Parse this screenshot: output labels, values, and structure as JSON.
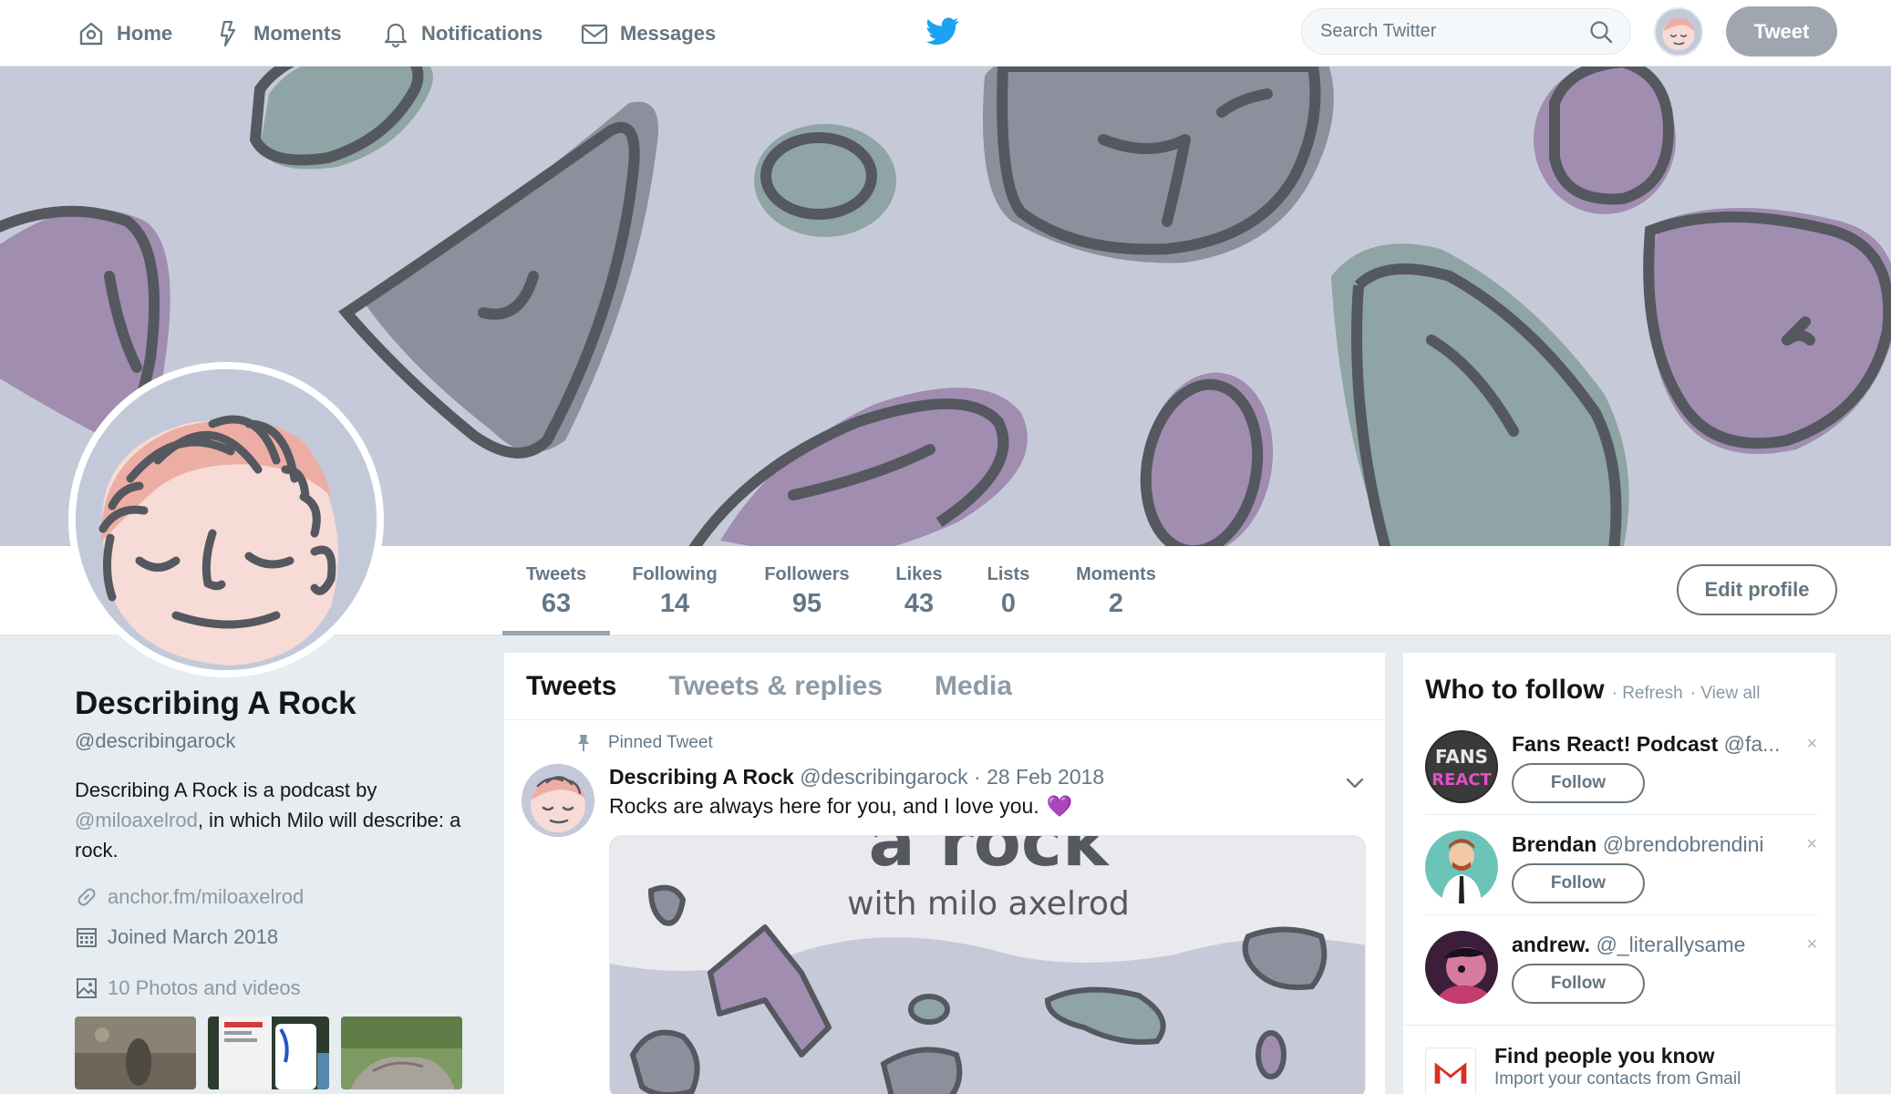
{
  "nav": {
    "home": "Home",
    "moments": "Moments",
    "notifications": "Notifications",
    "messages": "Messages",
    "search_placeholder": "Search Twitter",
    "tweet_button": "Tweet"
  },
  "profile": {
    "name": "Describing A Rock",
    "handle": "@describingarock",
    "bio_prefix": "Describing A Rock is a podcast by ",
    "bio_mention": "@miloaxelrod",
    "bio_suffix": ", in which Milo will describe: a rock.",
    "website": "anchor.fm/miloaxelrod",
    "joined": "Joined March 2018",
    "photos": "10 Photos and videos",
    "edit_button": "Edit profile"
  },
  "stats": [
    {
      "label": "Tweets",
      "value": "63"
    },
    {
      "label": "Following",
      "value": "14"
    },
    {
      "label": "Followers",
      "value": "95"
    },
    {
      "label": "Likes",
      "value": "43"
    },
    {
      "label": "Lists",
      "value": "0"
    },
    {
      "label": "Moments",
      "value": "2"
    }
  ],
  "timeline": {
    "tabs": [
      "Tweets",
      "Tweets & replies",
      "Media"
    ],
    "pinned_label": "Pinned Tweet",
    "tweet": {
      "name": "Describing A Rock",
      "handle": "@describingarock",
      "date": "· 28 Feb 2018",
      "text": "Rocks are always here for you, and I love you.",
      "heart": "💜",
      "media_title": "a rock",
      "media_subtitle": "with milo axelrod"
    }
  },
  "who_to_follow": {
    "title": "Who to follow",
    "refresh": "· Refresh",
    "view_all": "· View all",
    "suggestions": [
      {
        "name": "Fans React! Podcast",
        "handle": "@fa...",
        "button": "Follow",
        "dismiss": "×"
      },
      {
        "name": "Brendan",
        "handle": "@brendobrendini",
        "button": "Follow",
        "dismiss": "×"
      },
      {
        "name": "andrew.",
        "handle": "@_literallysame",
        "button": "Follow",
        "dismiss": "×"
      }
    ],
    "find_title": "Find people you know",
    "find_sub": "Import your contacts from Gmail"
  },
  "colors": {
    "banner_bg": "#c6cad8",
    "rock_teal": "#8fa4a4",
    "rock_grey": "#8c8f9c",
    "rock_purple": "#a08db0",
    "rock_outline": "#55585f",
    "twitter_blue": "#1da1f2"
  }
}
